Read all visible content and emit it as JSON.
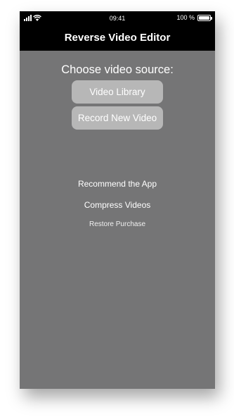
{
  "status_bar": {
    "time": "09:41",
    "battery_text": "100 %",
    "battery_level": 1.0
  },
  "nav": {
    "title": "Reverse Video Editor"
  },
  "main": {
    "heading": "Choose video source:",
    "buttons": {
      "library": "Video Library",
      "record": "Record New Video"
    },
    "links": {
      "recommend": "Recommend the App",
      "compress": "Compress Videos",
      "restore": "Restore Purchase"
    }
  },
  "colors": {
    "background": "#757576",
    "bar": "#000000",
    "button": "#b7b7b7",
    "text": "#ffffff"
  },
  "icons": [
    "signal-icon",
    "wifi-icon",
    "battery-icon"
  ]
}
